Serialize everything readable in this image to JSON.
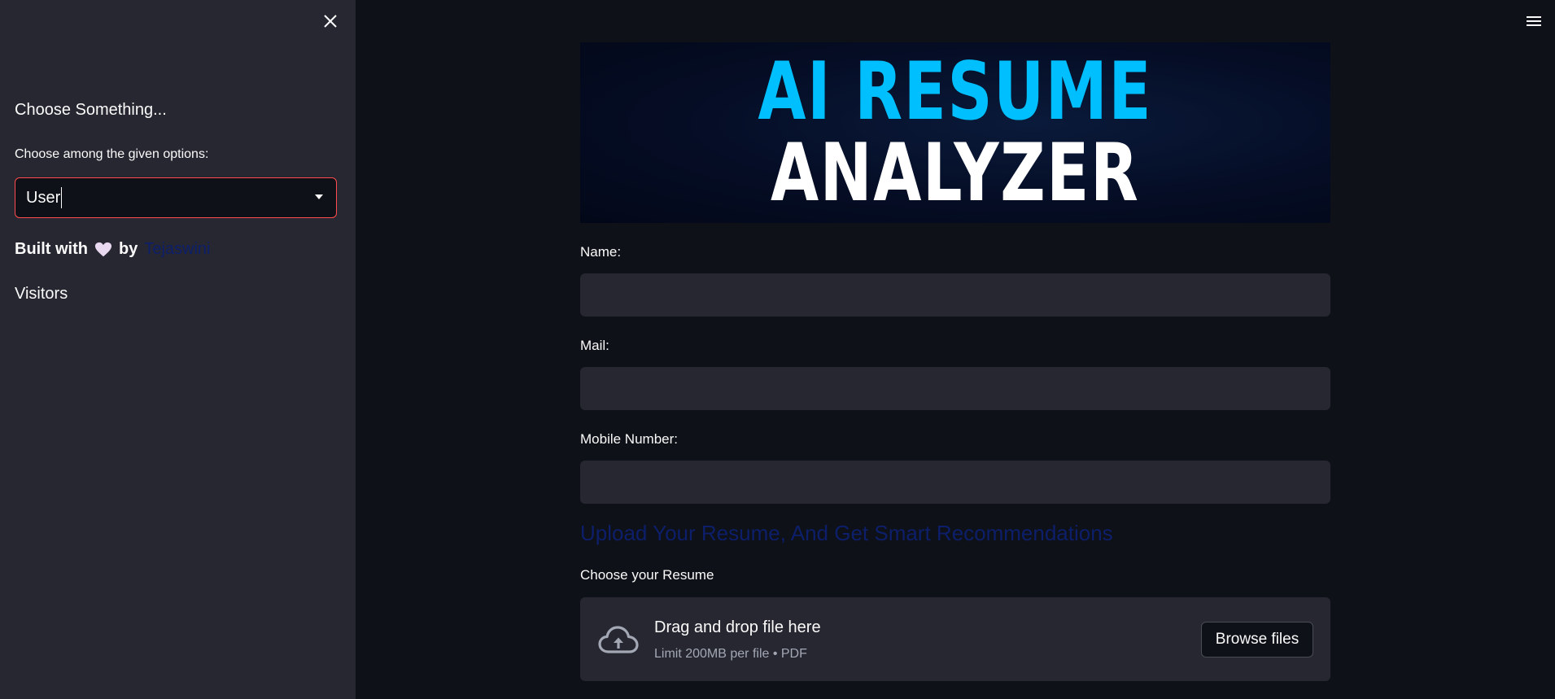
{
  "sidebar": {
    "heading": "Choose Something...",
    "select_label": "Choose among the given options:",
    "select_value": "User",
    "built_with_prefix": "Built with",
    "built_with_by": "by",
    "author": "Tejaswini",
    "visitors": "Visitors"
  },
  "banner": {
    "line1": "AI RESUME",
    "line2": "ANALYZER"
  },
  "form": {
    "name_label": "Name:",
    "name_value": "",
    "mail_label": "Mail:",
    "mail_value": "",
    "mobile_label": "Mobile Number:",
    "mobile_value": ""
  },
  "upload": {
    "heading": "Upload Your Resume, And Get Smart Recommendations",
    "label": "Choose your Resume",
    "dropzone_title": "Drag and drop file here",
    "dropzone_limit": "Limit 200MB per file • PDF",
    "browse_label": "Browse files"
  },
  "icons": {
    "close": "close-icon",
    "menu": "hamburger-menu-icon",
    "dropdown": "chevron-down-icon",
    "heart": "heart-icon",
    "upload": "cloud-upload-icon"
  },
  "colors": {
    "background": "#0e1117",
    "sidebar": "#262730",
    "accent_border": "#ff4b4b",
    "link": "#0d1f6b",
    "banner_cyan": "#00bfff",
    "heart": "#e8d8f0"
  }
}
